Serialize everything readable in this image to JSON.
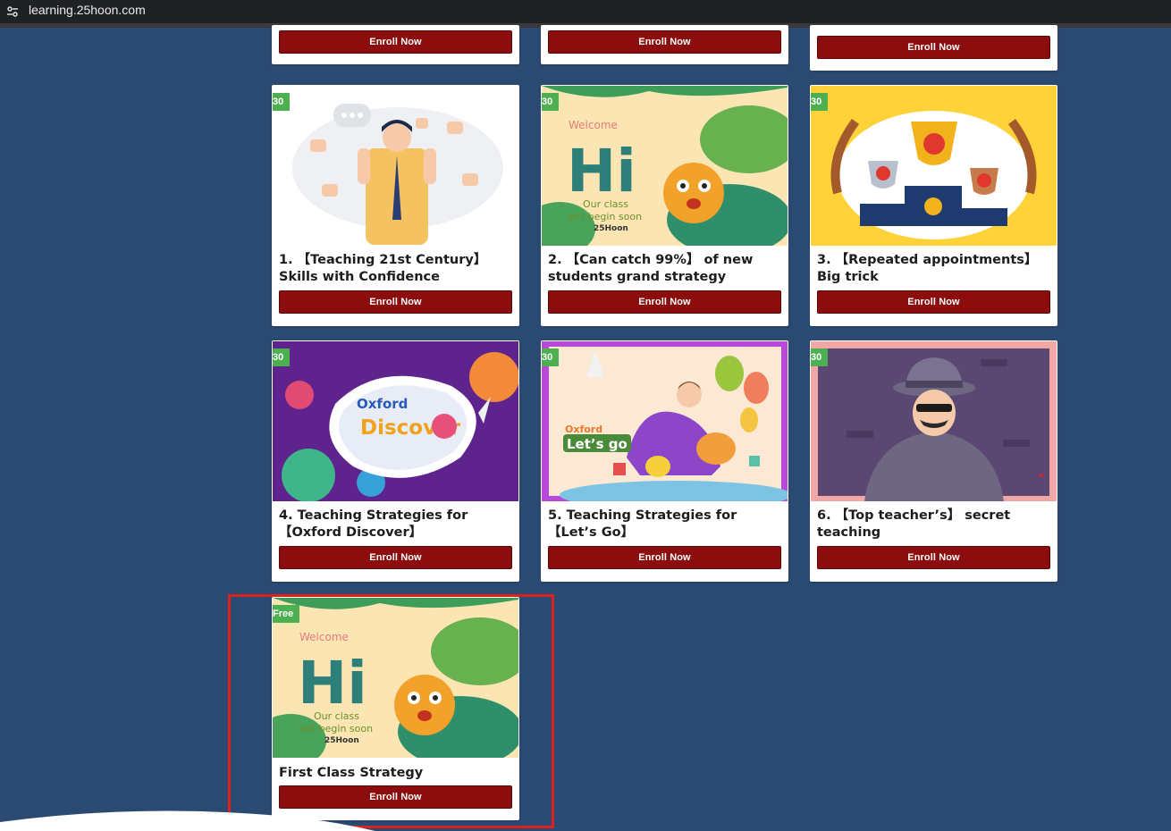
{
  "browser": {
    "url": "learning.25hoon.com"
  },
  "enroll_label": "Enroll Now",
  "accent_color": "#8b0d0d",
  "badge_color": "#4caf50",
  "courses": [
    {
      "badge": "30",
      "title": "1. 【Teaching 21st Century】 Skills with Confidence",
      "image": "thumbs-up-man-illustration"
    },
    {
      "badge": "30",
      "title": "2. 【Can catch 99%】 of new students grand strategy",
      "image": "welcome-hi-tiger-crocodile"
    },
    {
      "badge": "30",
      "title": "3. 【Repeated appointments】 Big trick",
      "image": "trophy-podium-illustration"
    },
    {
      "badge": "30",
      "title": "4. Teaching Strategies for 【Oxford Discover】",
      "image": "oxford-discover-space"
    },
    {
      "badge": "30",
      "title": "5. Teaching Strategies for 【Let’s Go】",
      "image": "oxford-lets-go-dinosaur"
    },
    {
      "badge": "30",
      "title": "6. 【Top teacher’s】 secret teaching",
      "image": "spy-detective-illustration"
    },
    {
      "badge": "Free",
      "title": "First Class Strategy",
      "image": "welcome-hi-tiger-crocodile"
    }
  ],
  "thumb_text": {
    "welcome": "Welcome",
    "hi": "Hi",
    "our_class": "Our class",
    "begin": "will begin soon",
    "brand": "25Hoon",
    "oxford": "Oxford",
    "discover": "Discover",
    "lets_go": "Let’s go"
  }
}
